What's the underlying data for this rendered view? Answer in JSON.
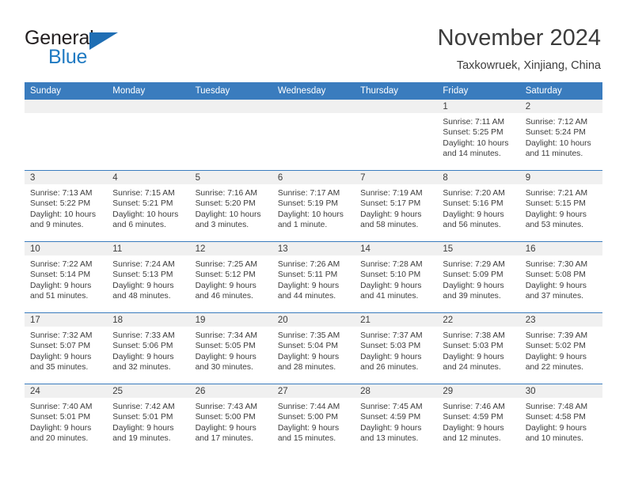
{
  "brand": {
    "word_one": "General",
    "word_two": "Blue",
    "triangle_color": "#1f6eb4"
  },
  "header": {
    "month_title": "November 2024",
    "location": "Taxkowruek, Xinjiang, China",
    "accent_color": "#3a7cbe",
    "band_color": "#f0f0f0"
  },
  "weekday_headers": [
    "Sunday",
    "Monday",
    "Tuesday",
    "Wednesday",
    "Thursday",
    "Friday",
    "Saturday"
  ],
  "labels": {
    "sunrise": "Sunrise:",
    "sunset": "Sunset:",
    "daylight": "Daylight:"
  },
  "weeks": [
    [
      {
        "day": "",
        "sunrise": "",
        "sunset": "",
        "daylight_line1": "",
        "daylight_line2": ""
      },
      {
        "day": "",
        "sunrise": "",
        "sunset": "",
        "daylight_line1": "",
        "daylight_line2": ""
      },
      {
        "day": "",
        "sunrise": "",
        "sunset": "",
        "daylight_line1": "",
        "daylight_line2": ""
      },
      {
        "day": "",
        "sunrise": "",
        "sunset": "",
        "daylight_line1": "",
        "daylight_line2": ""
      },
      {
        "day": "",
        "sunrise": "",
        "sunset": "",
        "daylight_line1": "",
        "daylight_line2": ""
      },
      {
        "day": "1",
        "sunrise": "Sunrise: 7:11 AM",
        "sunset": "Sunset: 5:25 PM",
        "daylight_line1": "Daylight: 10 hours",
        "daylight_line2": "and 14 minutes."
      },
      {
        "day": "2",
        "sunrise": "Sunrise: 7:12 AM",
        "sunset": "Sunset: 5:24 PM",
        "daylight_line1": "Daylight: 10 hours",
        "daylight_line2": "and 11 minutes."
      }
    ],
    [
      {
        "day": "3",
        "sunrise": "Sunrise: 7:13 AM",
        "sunset": "Sunset: 5:22 PM",
        "daylight_line1": "Daylight: 10 hours",
        "daylight_line2": "and 9 minutes."
      },
      {
        "day": "4",
        "sunrise": "Sunrise: 7:15 AM",
        "sunset": "Sunset: 5:21 PM",
        "daylight_line1": "Daylight: 10 hours",
        "daylight_line2": "and 6 minutes."
      },
      {
        "day": "5",
        "sunrise": "Sunrise: 7:16 AM",
        "sunset": "Sunset: 5:20 PM",
        "daylight_line1": "Daylight: 10 hours",
        "daylight_line2": "and 3 minutes."
      },
      {
        "day": "6",
        "sunrise": "Sunrise: 7:17 AM",
        "sunset": "Sunset: 5:19 PM",
        "daylight_line1": "Daylight: 10 hours",
        "daylight_line2": "and 1 minute."
      },
      {
        "day": "7",
        "sunrise": "Sunrise: 7:19 AM",
        "sunset": "Sunset: 5:17 PM",
        "daylight_line1": "Daylight: 9 hours",
        "daylight_line2": "and 58 minutes."
      },
      {
        "day": "8",
        "sunrise": "Sunrise: 7:20 AM",
        "sunset": "Sunset: 5:16 PM",
        "daylight_line1": "Daylight: 9 hours",
        "daylight_line2": "and 56 minutes."
      },
      {
        "day": "9",
        "sunrise": "Sunrise: 7:21 AM",
        "sunset": "Sunset: 5:15 PM",
        "daylight_line1": "Daylight: 9 hours",
        "daylight_line2": "and 53 minutes."
      }
    ],
    [
      {
        "day": "10",
        "sunrise": "Sunrise: 7:22 AM",
        "sunset": "Sunset: 5:14 PM",
        "daylight_line1": "Daylight: 9 hours",
        "daylight_line2": "and 51 minutes."
      },
      {
        "day": "11",
        "sunrise": "Sunrise: 7:24 AM",
        "sunset": "Sunset: 5:13 PM",
        "daylight_line1": "Daylight: 9 hours",
        "daylight_line2": "and 48 minutes."
      },
      {
        "day": "12",
        "sunrise": "Sunrise: 7:25 AM",
        "sunset": "Sunset: 5:12 PM",
        "daylight_line1": "Daylight: 9 hours",
        "daylight_line2": "and 46 minutes."
      },
      {
        "day": "13",
        "sunrise": "Sunrise: 7:26 AM",
        "sunset": "Sunset: 5:11 PM",
        "daylight_line1": "Daylight: 9 hours",
        "daylight_line2": "and 44 minutes."
      },
      {
        "day": "14",
        "sunrise": "Sunrise: 7:28 AM",
        "sunset": "Sunset: 5:10 PM",
        "daylight_line1": "Daylight: 9 hours",
        "daylight_line2": "and 41 minutes."
      },
      {
        "day": "15",
        "sunrise": "Sunrise: 7:29 AM",
        "sunset": "Sunset: 5:09 PM",
        "daylight_line1": "Daylight: 9 hours",
        "daylight_line2": "and 39 minutes."
      },
      {
        "day": "16",
        "sunrise": "Sunrise: 7:30 AM",
        "sunset": "Sunset: 5:08 PM",
        "daylight_line1": "Daylight: 9 hours",
        "daylight_line2": "and 37 minutes."
      }
    ],
    [
      {
        "day": "17",
        "sunrise": "Sunrise: 7:32 AM",
        "sunset": "Sunset: 5:07 PM",
        "daylight_line1": "Daylight: 9 hours",
        "daylight_line2": "and 35 minutes."
      },
      {
        "day": "18",
        "sunrise": "Sunrise: 7:33 AM",
        "sunset": "Sunset: 5:06 PM",
        "daylight_line1": "Daylight: 9 hours",
        "daylight_line2": "and 32 minutes."
      },
      {
        "day": "19",
        "sunrise": "Sunrise: 7:34 AM",
        "sunset": "Sunset: 5:05 PM",
        "daylight_line1": "Daylight: 9 hours",
        "daylight_line2": "and 30 minutes."
      },
      {
        "day": "20",
        "sunrise": "Sunrise: 7:35 AM",
        "sunset": "Sunset: 5:04 PM",
        "daylight_line1": "Daylight: 9 hours",
        "daylight_line2": "and 28 minutes."
      },
      {
        "day": "21",
        "sunrise": "Sunrise: 7:37 AM",
        "sunset": "Sunset: 5:03 PM",
        "daylight_line1": "Daylight: 9 hours",
        "daylight_line2": "and 26 minutes."
      },
      {
        "day": "22",
        "sunrise": "Sunrise: 7:38 AM",
        "sunset": "Sunset: 5:03 PM",
        "daylight_line1": "Daylight: 9 hours",
        "daylight_line2": "and 24 minutes."
      },
      {
        "day": "23",
        "sunrise": "Sunrise: 7:39 AM",
        "sunset": "Sunset: 5:02 PM",
        "daylight_line1": "Daylight: 9 hours",
        "daylight_line2": "and 22 minutes."
      }
    ],
    [
      {
        "day": "24",
        "sunrise": "Sunrise: 7:40 AM",
        "sunset": "Sunset: 5:01 PM",
        "daylight_line1": "Daylight: 9 hours",
        "daylight_line2": "and 20 minutes."
      },
      {
        "day": "25",
        "sunrise": "Sunrise: 7:42 AM",
        "sunset": "Sunset: 5:01 PM",
        "daylight_line1": "Daylight: 9 hours",
        "daylight_line2": "and 19 minutes."
      },
      {
        "day": "26",
        "sunrise": "Sunrise: 7:43 AM",
        "sunset": "Sunset: 5:00 PM",
        "daylight_line1": "Daylight: 9 hours",
        "daylight_line2": "and 17 minutes."
      },
      {
        "day": "27",
        "sunrise": "Sunrise: 7:44 AM",
        "sunset": "Sunset: 5:00 PM",
        "daylight_line1": "Daylight: 9 hours",
        "daylight_line2": "and 15 minutes."
      },
      {
        "day": "28",
        "sunrise": "Sunrise: 7:45 AM",
        "sunset": "Sunset: 4:59 PM",
        "daylight_line1": "Daylight: 9 hours",
        "daylight_line2": "and 13 minutes."
      },
      {
        "day": "29",
        "sunrise": "Sunrise: 7:46 AM",
        "sunset": "Sunset: 4:59 PM",
        "daylight_line1": "Daylight: 9 hours",
        "daylight_line2": "and 12 minutes."
      },
      {
        "day": "30",
        "sunrise": "Sunrise: 7:48 AM",
        "sunset": "Sunset: 4:58 PM",
        "daylight_line1": "Daylight: 9 hours",
        "daylight_line2": "and 10 minutes."
      }
    ]
  ]
}
